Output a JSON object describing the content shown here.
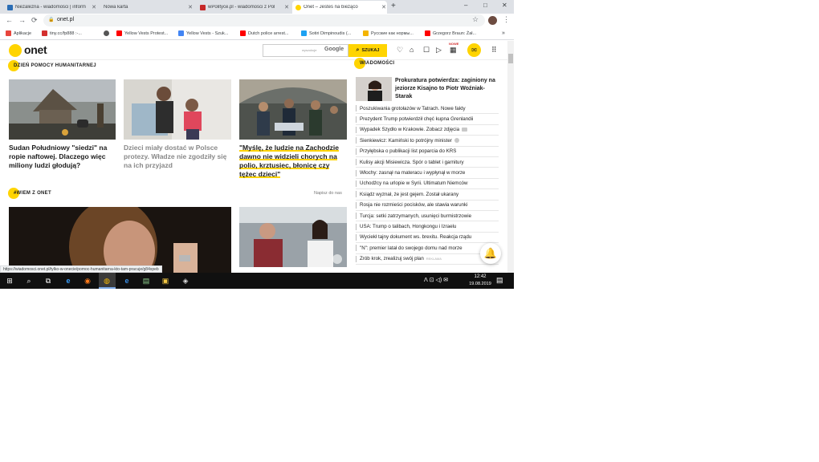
{
  "browser": {
    "tabs": [
      {
        "title": "Niezależna - wiadomości | inform",
        "favicon_color": "#2a6db5",
        "active": false
      },
      {
        "title": "Nowa karta",
        "favicon_color": "",
        "active": false
      },
      {
        "title": "wPolityce.pl - wiadomości z Pol",
        "favicon_color": "#c62828",
        "active": false
      },
      {
        "title": "Onet – Jesteś na bieżąco",
        "favicon_color": "#ffd400",
        "active": true
      }
    ],
    "new_tab": "+",
    "window_controls": [
      "–",
      "□",
      "✕"
    ],
    "nav": {
      "back": "←",
      "forward": "→",
      "reload": "⟳"
    },
    "url": "onet.pl",
    "lock": "🔒",
    "star": "☆",
    "menu": "⋮",
    "bookmarks": [
      {
        "label": "Aplikacje",
        "color": "#e8453c"
      },
      {
        "label": "tiny.cc/fp888 :-...",
        "color": "#d32f2f"
      },
      {
        "label": "",
        "color": "#555555"
      },
      {
        "label": "Yellow Vests Protest...",
        "color": "#ff0000"
      },
      {
        "label": "Yellow Vests - Szuk...",
        "color": "#4285f4"
      },
      {
        "label": "Dutch police arrest...",
        "color": "#ff0000"
      },
      {
        "label": "Sotiri Dimpinoudis (...",
        "color": "#1da1f2"
      },
      {
        "label": "Русские как нормы...",
        "color": "#f4b400"
      },
      {
        "label": "Grzegorz Braun: Żał...",
        "color": "#ff0000"
      }
    ],
    "status_url": "https://wiadomosci.onet.pl/tylko-w-onecie/pomoc-humanitarna-kto-tam-pracuje/g84xpeb"
  },
  "onet": {
    "logo": "onet",
    "search_hint": "wyszukuje",
    "search_google": "Google",
    "search_button": "SZUKAJ",
    "search_icon": "⌕",
    "nowe_badge": "NOWE",
    "header_icons": [
      "♡",
      "⌂",
      "☐",
      "▷",
      "▦",
      "✉",
      "⠿"
    ],
    "sections": {
      "humanitarian": "DZIEŃ POMOCY HUMANITARNEJ",
      "wiem": "#WIEM Z ONET",
      "wiadomosci": "WIADOMOŚCI"
    },
    "napisz": "Napisz do nas",
    "cards": [
      {
        "title": "Sudan Południowy \"siedzi\" na ropie naftowej. Dlaczego więc miliony ludzi głodują?",
        "style": "normal"
      },
      {
        "title": "Dzieci miały dostać w Polsce protezy. Władze nie zgodziły się na ich przyjazd",
        "style": "gray"
      },
      {
        "title": "\"Myślę, że ludzie na Zachodzie dawno nie widzieli chorych na polio, krztusiec, błonicę czy tężec dzieci\"",
        "style": "highlight"
      }
    ],
    "lead_news": "Prokuratura potwierdza: zaginiony na jeziorze Kisajno to Piotr Woźniak-Starak",
    "news": [
      {
        "text": "Poszukiwania grotołazów w Tatrach. Nowe fakty",
        "extra": ""
      },
      {
        "text": "Prezydent Trump potwierdził chęć kupna Grenlandii",
        "extra": ""
      },
      {
        "text": "Wypadek Szydło w Krakowie. Zobacz zdjęcia",
        "extra": "camera"
      },
      {
        "text": "Sienkiewicz: Kamiński to potrójny minister",
        "extra": "play"
      },
      {
        "text": "Przyłębska o publikacji list poparcia do KRS",
        "extra": ""
      },
      {
        "text": "Kulisy akcji Misiewicza. Spór o tablet i garnitury",
        "extra": ""
      },
      {
        "text": "Włochy: zasnął na materacu i wypłynął w morze",
        "extra": ""
      },
      {
        "text": "Uchodźcy na urlopie w Syrii. Ultimatum Niemców",
        "extra": ""
      },
      {
        "text": "Ksiądz wyznał, że jest gejem. Został ukarany",
        "extra": ""
      },
      {
        "text": "Rosja nie rozmieści pocisków, ale stawia warunki",
        "extra": ""
      },
      {
        "text": "Turcja: setki zatrzymanych, usunięci burmistrzowie",
        "extra": ""
      },
      {
        "text": "USA: Trump o talibach, Hongkongu i Izraelu",
        "extra": ""
      },
      {
        "text": "Wyciekł tajny dokument ws. brexitu. Reakcja rządu",
        "extra": ""
      },
      {
        "text": "\"N\": premier latał do swojego domu nad morze",
        "extra": ""
      },
      {
        "text": "Zrób krok, zrealizuj swój plan",
        "extra": "REKLAMA"
      }
    ],
    "bell_icon": "🔔"
  },
  "taskbar": {
    "clock_time": "12:42",
    "clock_date": "19.08.2019",
    "tray": "ᐱ  ⊡  ◁)  ✉",
    "icons": [
      "⊞",
      "⌕",
      "⧉",
      "e",
      "◉",
      "◍",
      "e",
      "▤",
      "▣",
      "◈"
    ]
  }
}
